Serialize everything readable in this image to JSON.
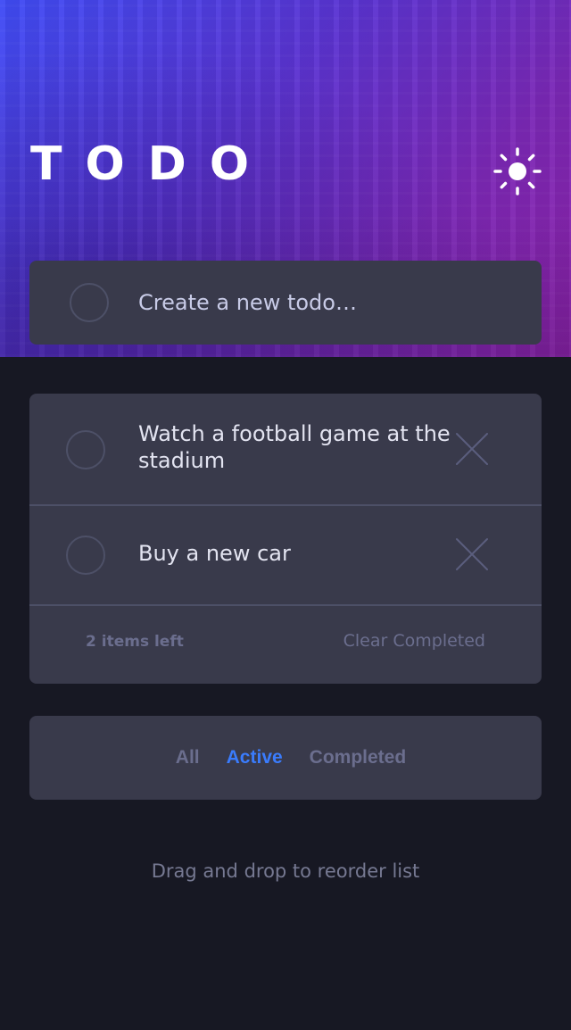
{
  "app": {
    "title": "TODO",
    "theme_icon": "sun-icon"
  },
  "new_todo": {
    "placeholder": "Create a new todo…"
  },
  "todos": [
    {
      "text": "Watch a football game at the stadium",
      "completed": false
    },
    {
      "text": "Buy a new car",
      "completed": false
    }
  ],
  "list_footer": {
    "items_left": "2 items left",
    "clear_label": "Clear Completed"
  },
  "filters": {
    "all": "All",
    "active": "Active",
    "completed": "Completed",
    "selected": "Active"
  },
  "hint": "Drag and drop to reorder list",
  "colors": {
    "accent": "#3a7cfd",
    "card": "#393a4b",
    "background": "#171823",
    "hero_start": "#3f4cf5",
    "hero_end": "#8f22a8"
  }
}
